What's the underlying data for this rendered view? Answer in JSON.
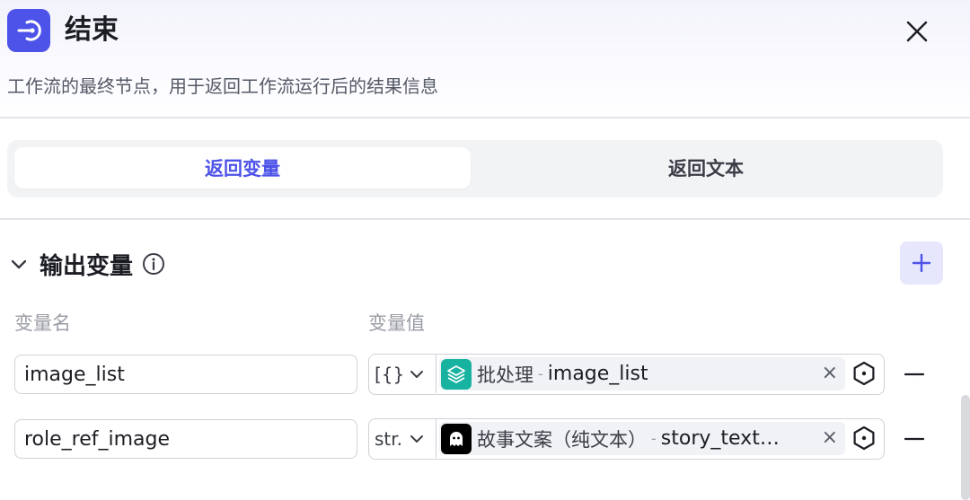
{
  "header": {
    "icon": "exit-node-icon",
    "title": "结束",
    "description": "工作流的最终节点，用于返回工作流运行后的结果信息",
    "accent_color": "#4d53e8"
  },
  "tabs": [
    {
      "label": "返回变量",
      "active": true
    },
    {
      "label": "返回文本",
      "active": false
    }
  ],
  "output_section": {
    "title": "输出变量",
    "col_name": "变量名",
    "col_value": "变量值",
    "rows": [
      {
        "name": "image_list",
        "type": "[{}]",
        "source_icon": "batch-icon",
        "source_name": "批处理",
        "separator": "-",
        "variable": "image_list"
      },
      {
        "name": "role_ref_image",
        "type": "str.",
        "source_icon": "ghost-avatar-icon",
        "source_name": "故事文案（纯文本）",
        "separator": "-",
        "variable": "story_text…"
      }
    ]
  }
}
